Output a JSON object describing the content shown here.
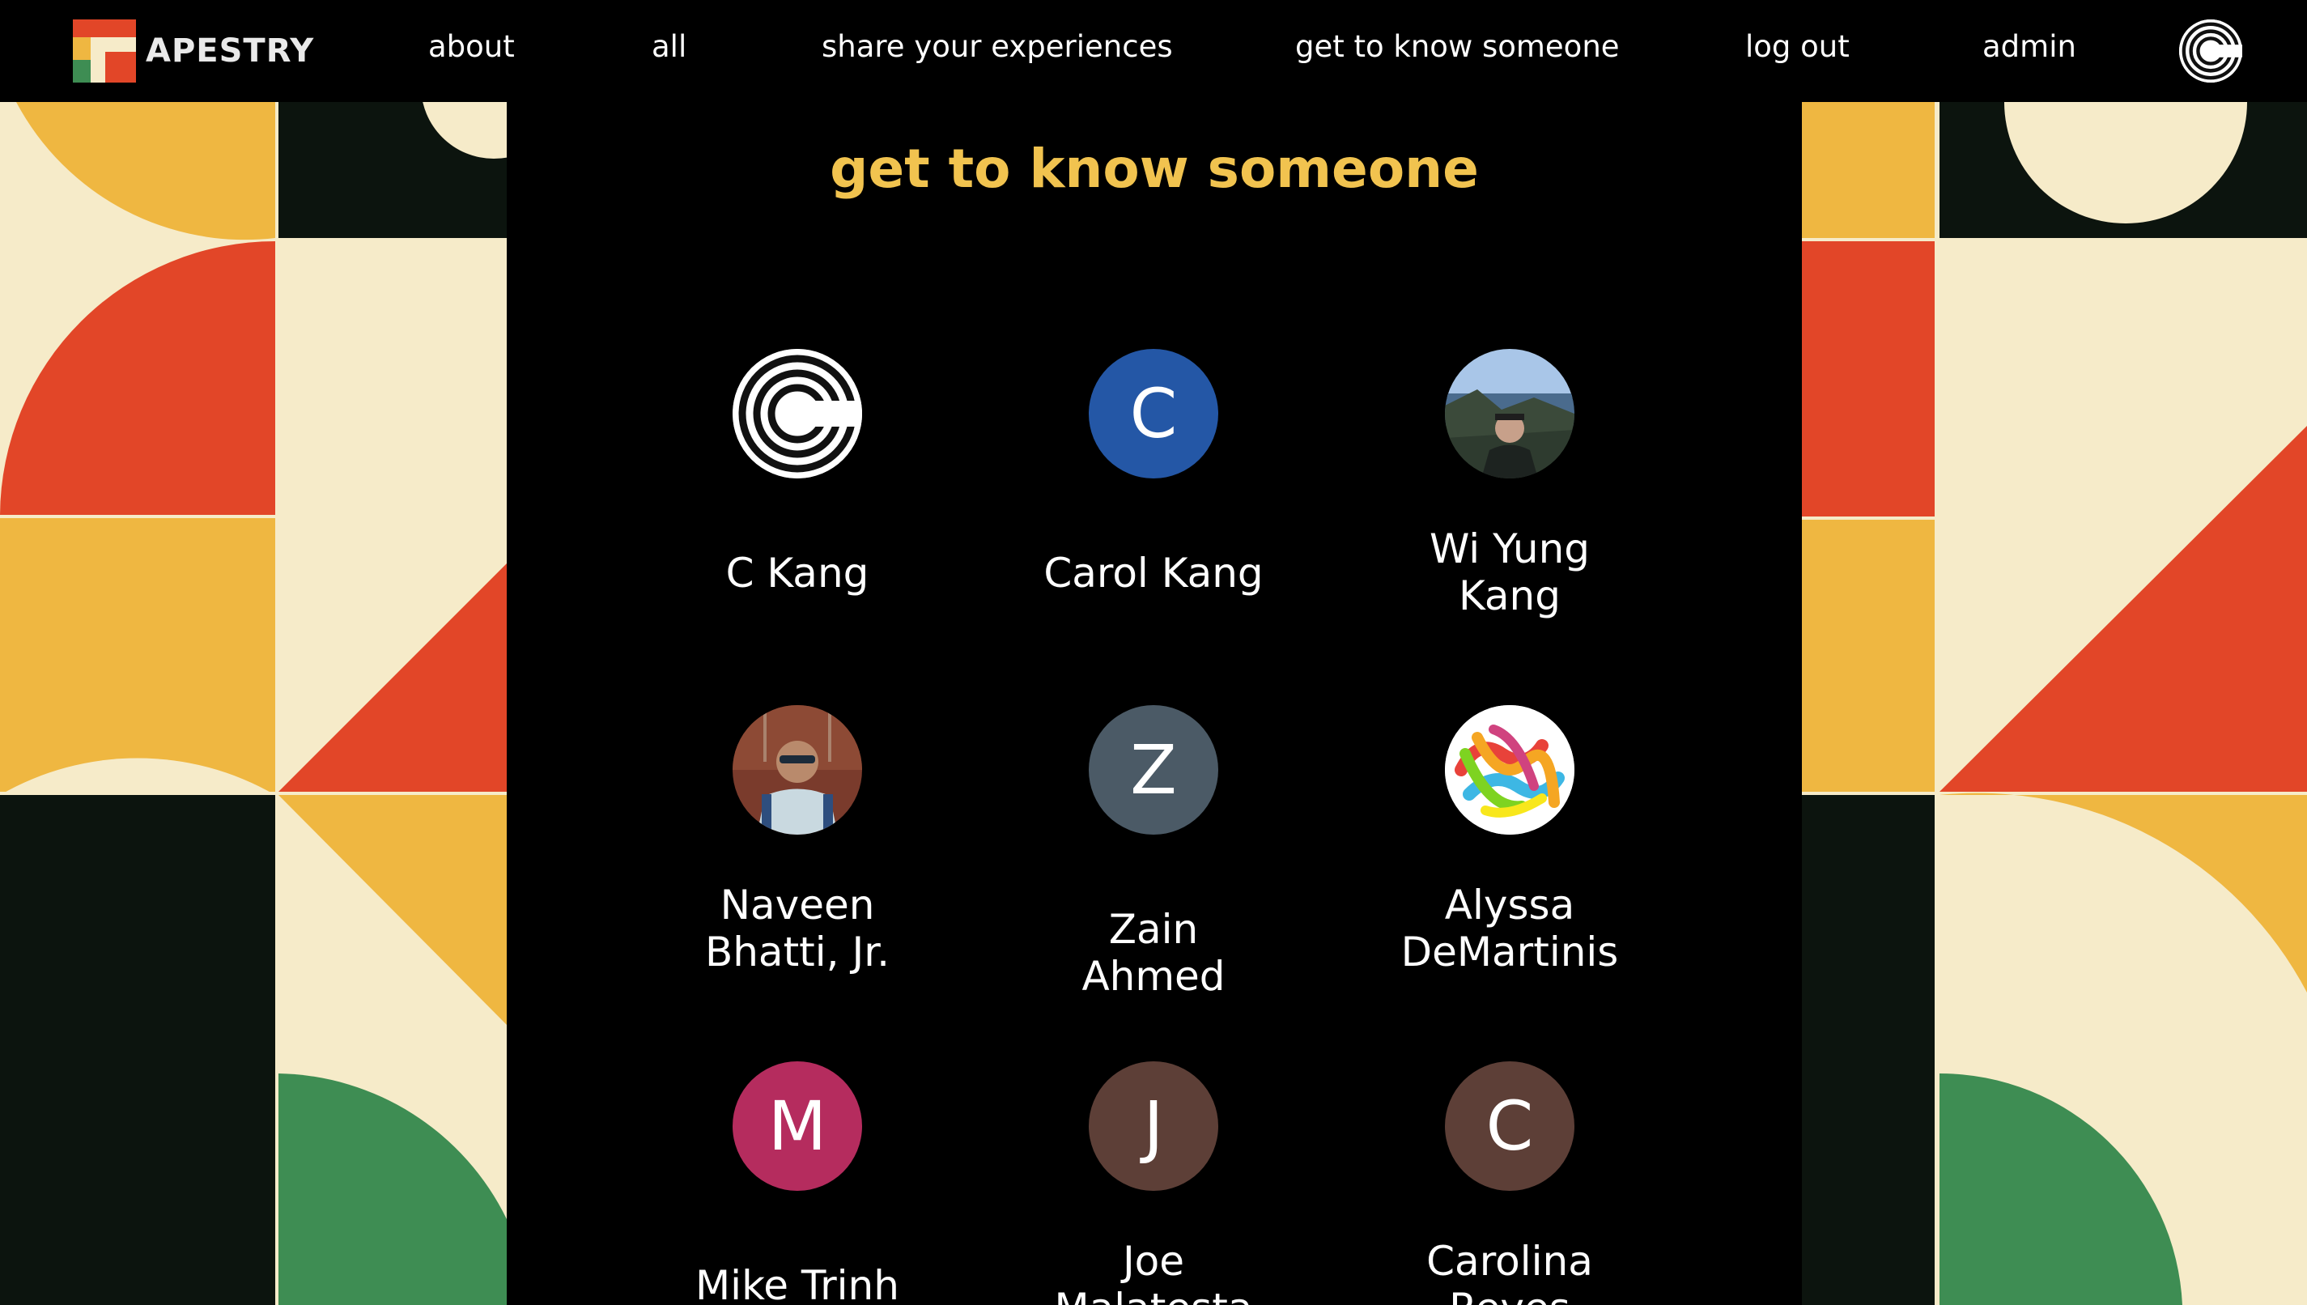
{
  "brand": {
    "logo_text": "APESTRY",
    "colors": {
      "yellow": "#f1c34f",
      "red": "#e24628",
      "green": "#3e8d53",
      "cream": "#f6ebc9",
      "black": "#000000"
    }
  },
  "nav": {
    "links": [
      "about",
      "all",
      "share your experiences",
      "get to know someone",
      "log out",
      "admin"
    ],
    "avatar_icon": "c-logo-icon"
  },
  "page": {
    "title": "get to know someone"
  },
  "people": [
    {
      "name": "C Kang",
      "avatar_type": "logo",
      "avatar_icon": "c-logo-icon"
    },
    {
      "name": "Carol Kang",
      "avatar_type": "letter",
      "letter": "C",
      "color": "#2457a6"
    },
    {
      "name": "Wi Yung Kang",
      "avatar_type": "photo",
      "avatar_icon": "coastal-photo"
    },
    {
      "name": "Naveen Bhatti, Jr.",
      "avatar_type": "photo",
      "avatar_icon": "portrait-photo"
    },
    {
      "name": "Zain Ahmed",
      "avatar_type": "letter",
      "letter": "Z",
      "color": "#4b5a66"
    },
    {
      "name": "Alyssa DeMartinis",
      "avatar_type": "photo",
      "avatar_icon": "gummy-worms-photo"
    },
    {
      "name": "Mike Trinh",
      "avatar_type": "letter",
      "letter": "M",
      "color": "#b52c5e"
    },
    {
      "name": "Joe Malatesta",
      "avatar_type": "letter",
      "letter": "J",
      "color": "#5d3f37"
    },
    {
      "name": "Carolina Reyes",
      "avatar_type": "letter",
      "letter": "C",
      "color": "#5d3f37"
    }
  ]
}
